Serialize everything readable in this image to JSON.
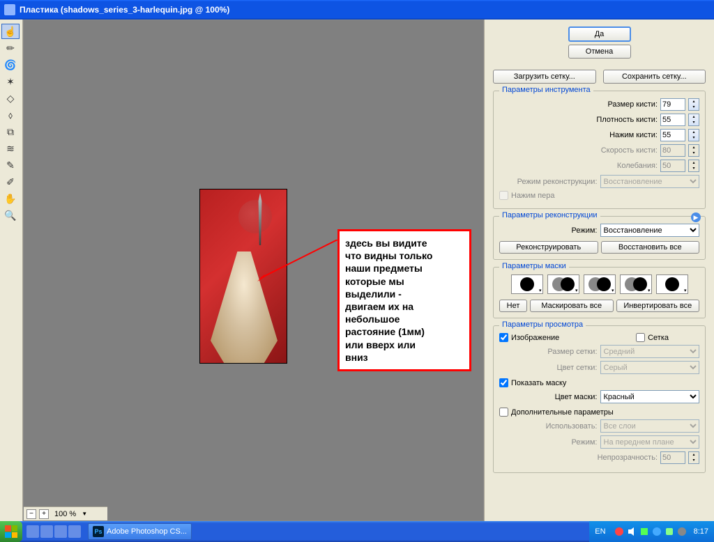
{
  "titlebar": "Пластика (shadows_series_3-harlequin.jpg @ 100%)",
  "zoom": {
    "value": "100 %"
  },
  "annotation": "здесь вы видите\nчто видны только\nнаши предметы\nкоторые мы\nвыделили -\nдвигаем их на\nнебольшое\nрастояние (1мм)\nили вверх или\nвниз",
  "buttons": {
    "ok": "Да",
    "cancel": "Отмена",
    "load_mesh": "Загрузить сетку...",
    "save_mesh": "Сохранить сетку...",
    "reconstruct": "Реконструировать",
    "restore_all": "Восстановить все",
    "none": "Нет",
    "mask_all": "Маскировать все",
    "invert_all": "Инвертировать все"
  },
  "groups": {
    "tool_options": "Параметры инструмента",
    "reconstruct": "Параметры реконструкции",
    "mask": "Параметры маски",
    "view": "Параметры просмотра"
  },
  "tool": {
    "brush_size_label": "Размер кисти:",
    "brush_size": "79",
    "brush_density_label": "Плотность кисти:",
    "brush_density": "55",
    "brush_pressure_label": "Нажим кисти:",
    "brush_pressure": "55",
    "brush_rate_label": "Скорость кисти:",
    "brush_rate": "80",
    "turbulence_label": "Колебания:",
    "turbulence": "50",
    "recon_mode_label": "Режим реконструкции:",
    "recon_mode": "Восстановление",
    "pen_pressure": "Нажим пера"
  },
  "recon": {
    "mode_label": "Режим:",
    "mode": "Восстановление"
  },
  "view": {
    "show_image": "Изображение",
    "show_mesh": "Сетка",
    "mesh_size_label": "Размер сетки:",
    "mesh_size": "Средний",
    "mesh_color_label": "Цвет сетки:",
    "mesh_color": "Серый",
    "show_mask": "Показать маску",
    "mask_color_label": "Цвет маски:",
    "mask_color": "Красный",
    "add_params": "Дополнительные параметры",
    "use_label": "Использовать:",
    "use": "Все слои",
    "mode_label": "Режим:",
    "mode": "На переднем плане",
    "opacity_label": "Непрозрачность:",
    "opacity": "50"
  },
  "taskbar": {
    "app": "Adobe Photoshop CS...",
    "lang": "EN",
    "time": "8:17"
  }
}
